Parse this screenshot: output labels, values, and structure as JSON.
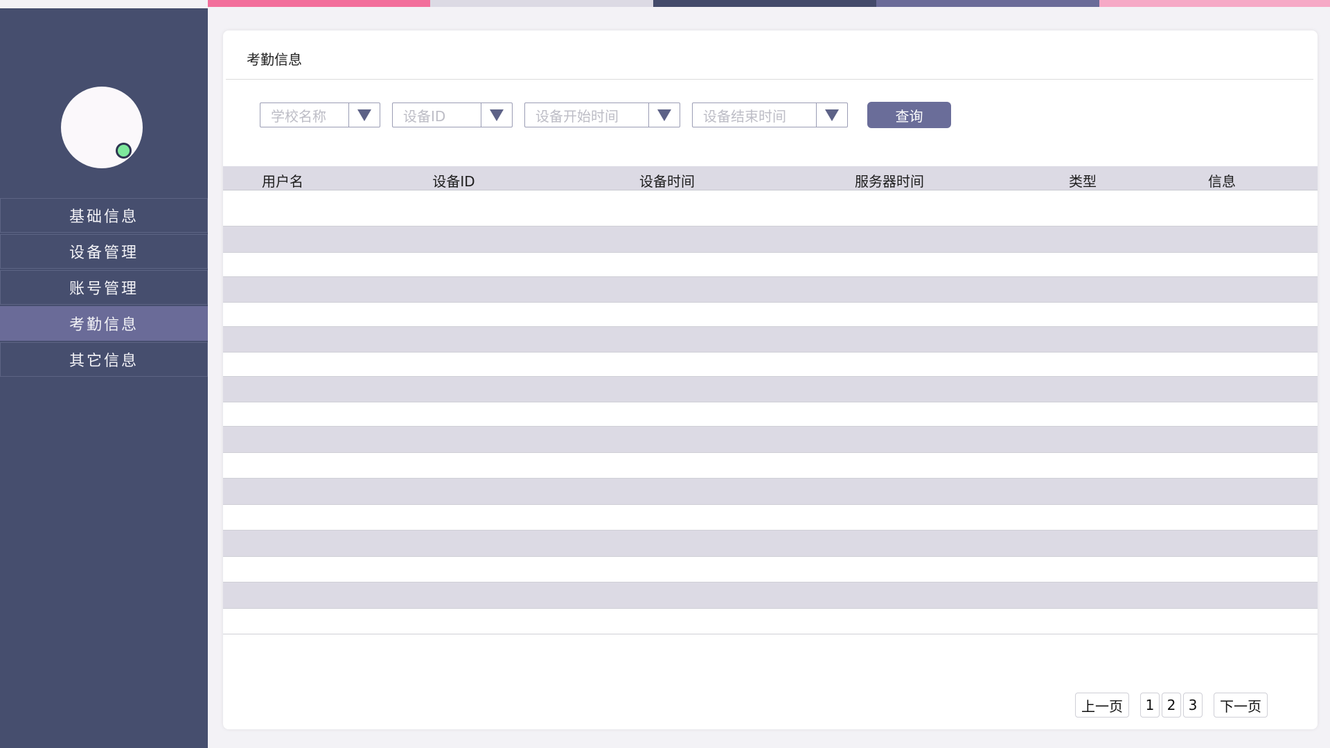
{
  "colors": {
    "top_strip": [
      "#f26e9b",
      "#dcdae4",
      "#434a6a",
      "#6a6b98",
      "#f6a9c6"
    ],
    "sidebar_bg": "#464e6e",
    "nav_active": "#6a6b98",
    "query_button": "#6a6d99",
    "status_online": "#7ee89c"
  },
  "sidebar": {
    "avatar": {
      "status": "online"
    },
    "items": [
      {
        "label": "基础信息",
        "active": false
      },
      {
        "label": "设备管理",
        "active": false
      },
      {
        "label": "账号管理",
        "active": false
      },
      {
        "label": "考勤信息",
        "active": true
      },
      {
        "label": "其它信息",
        "active": false
      }
    ]
  },
  "main": {
    "title": "考勤信息",
    "filters": [
      {
        "placeholder": "学校名称"
      },
      {
        "placeholder": "设备ID"
      },
      {
        "placeholder": "设备开始时间"
      },
      {
        "placeholder": "设备结束时间"
      }
    ],
    "query_label": "查询",
    "table": {
      "columns": [
        "用户名",
        "设备ID",
        "设备时间",
        "服务器时间",
        "类型",
        "信息"
      ],
      "rows": []
    },
    "pagination": {
      "prev_label": "上一页",
      "pages": [
        "1",
        "2",
        "3"
      ],
      "next_label": "下一页"
    }
  }
}
